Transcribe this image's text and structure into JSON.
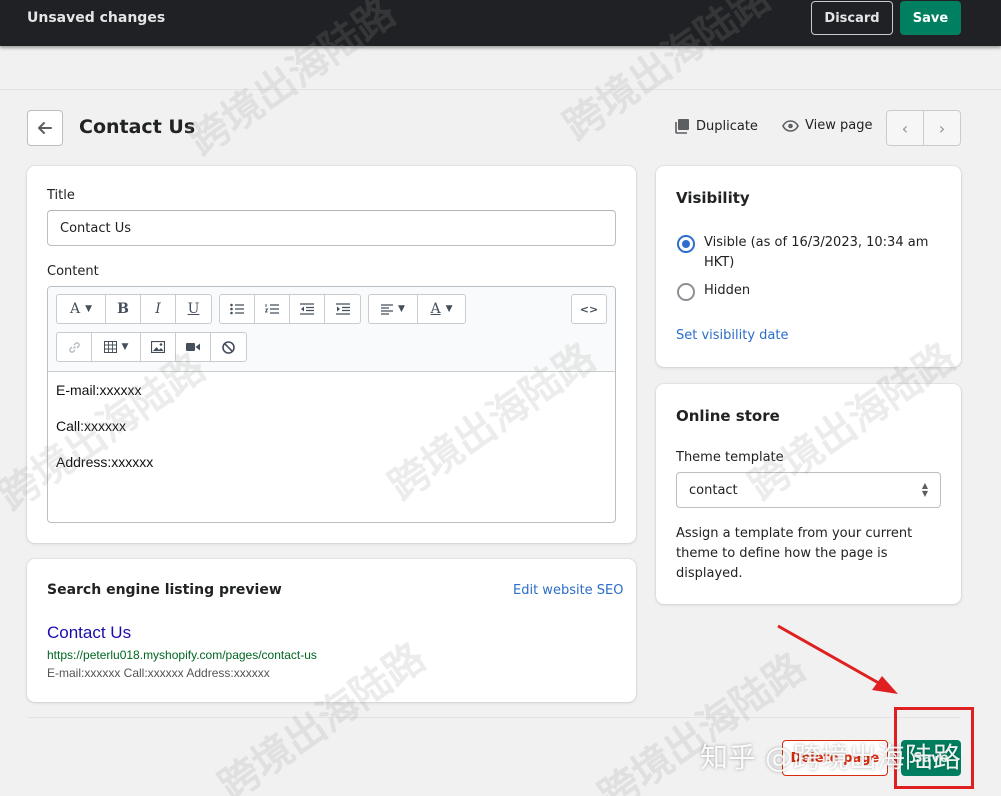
{
  "topbar": {
    "title": "Unsaved changes",
    "discard_label": "Discard",
    "save_label": "Save"
  },
  "header": {
    "title": "Contact Us",
    "duplicate_label": "Duplicate",
    "view_page_label": "View page",
    "prev_icon": "chevron-left-icon",
    "next_icon": "chevron-right-icon"
  },
  "content_card": {
    "title_label": "Title",
    "title_value": "Contact Us",
    "content_label": "Content",
    "toolbar_row1": [
      "font-icon",
      "bold-icon",
      "italic-icon",
      "underline-icon",
      "bulleted-list-icon",
      "numbered-list-icon",
      "outdent-icon",
      "indent-icon",
      "align-icon",
      "text-color-icon",
      "html-icon"
    ],
    "toolbar_row2": [
      "link-icon",
      "table-icon",
      "image-icon",
      "video-icon",
      "clear-format-icon"
    ],
    "body_lines": [
      "E-mail:xxxxxx",
      "Call:xxxxxx",
      "Address:xxxxxx"
    ]
  },
  "seo_card": {
    "title": "Search engine listing preview",
    "edit_link": "Edit website SEO",
    "preview_title": "Contact Us",
    "preview_url": "https://peterlu018.myshopify.com/pages/contact-us",
    "preview_description": "E-mail:xxxxxx Call:xxxxxx Address:xxxxxx"
  },
  "visibility_card": {
    "title": "Visibility",
    "options": [
      {
        "label": "Visible (as of 16/3/2023, 10:34 am",
        "label_line2": "HKT)",
        "selected": true
      },
      {
        "label": "Hidden",
        "selected": false
      }
    ],
    "set_date_link": "Set visibility date"
  },
  "online_store_card": {
    "title": "Online store",
    "template_label": "Theme template",
    "template_value": "contact",
    "help_text": "Assign a template from your current theme to define how the page is displayed."
  },
  "footer": {
    "delete_label": "Delete page",
    "save_label": "Save"
  },
  "watermark": {
    "text": "跨境出海陆路",
    "zhihu_text": "知乎 @跨境出海陆路"
  },
  "colors": {
    "primary": "#008060",
    "critical": "#d82c0d",
    "link": "#2c6ecb",
    "annotation": "#e02020"
  }
}
